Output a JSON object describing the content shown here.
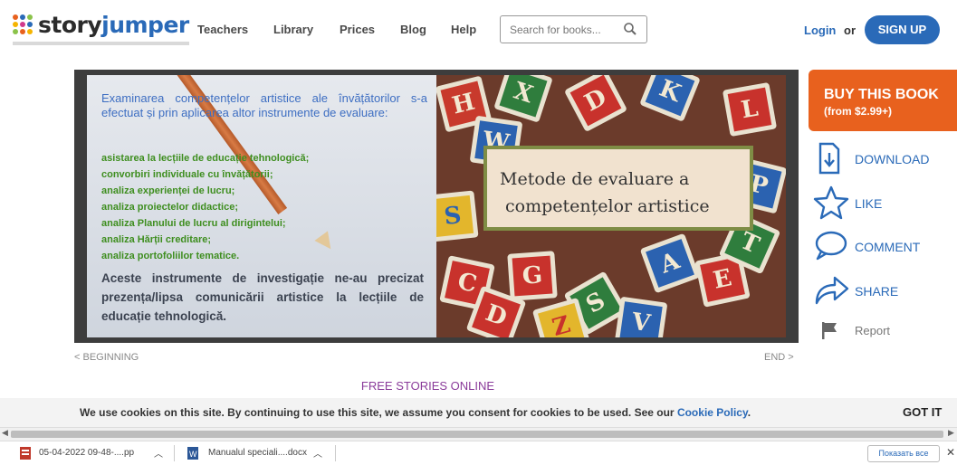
{
  "header": {
    "logo_a": "story",
    "logo_b": "jumper",
    "nav": [
      "Teachers",
      "Library",
      "Prices",
      "Blog",
      "Help"
    ],
    "search_placeholder": "Search for books...",
    "login": "Login",
    "or": "or",
    "signup": "SIGN UP"
  },
  "book": {
    "left_blue": "Examinarea competențelor artistice ale învățătorilor s-a efectuat și prin aplicarea altor instrumente de evaluare:",
    "left_green": [
      " asistarea la lecțiile de educație tehnologică;",
      "convorbiri individuale cu învățătorii;",
      "analiza experienței de lucru;",
      " analiza proiectelor didactice;",
      "analiza Planului de lucru al dirigintelui;",
      "analiza Hărții creditare;",
      "analiza portofoliilor tematice."
    ],
    "left_dark": "Aceste instrumente de investigație ne-au precizat prezența/lipsa comunicării artistice la lecțiile de educație tehnologică.",
    "title_line1": "Metode de evaluare a",
    "title_line2": "competențelor artistice",
    "blocks": [
      "H",
      "X",
      "D",
      "K",
      "W",
      "L",
      "P",
      "S",
      "C",
      "G",
      "A",
      "D",
      "S",
      "V",
      "E",
      "T",
      "Z"
    ]
  },
  "side": {
    "buy_title": "BUY THIS BOOK",
    "buy_price": "(from $2.99+)",
    "download": "DOWNLOAD",
    "like": "LIKE",
    "comment": "COMMENT",
    "share": "SHARE",
    "report": "Report"
  },
  "nav_links": {
    "beginning": "< BEGINNING",
    "end": "END >",
    "free": "FREE STORIES ONLINE"
  },
  "cookie": {
    "message": "We use cookies on this site. By continuing to use this site, we assume you consent for cookies to be used. See our ",
    "link": "Cookie Policy",
    "period": ".",
    "gotit": "GOT IT"
  },
  "downloads": {
    "item1": "05-04-2022 09-48-....pp",
    "item2": "Manualul speciali....docx",
    "show_all": "Показать все"
  },
  "colors": {
    "brand_blue": "#2a6ab8",
    "buy_orange": "#e8611e",
    "free_purple": "#8a3b9a"
  }
}
